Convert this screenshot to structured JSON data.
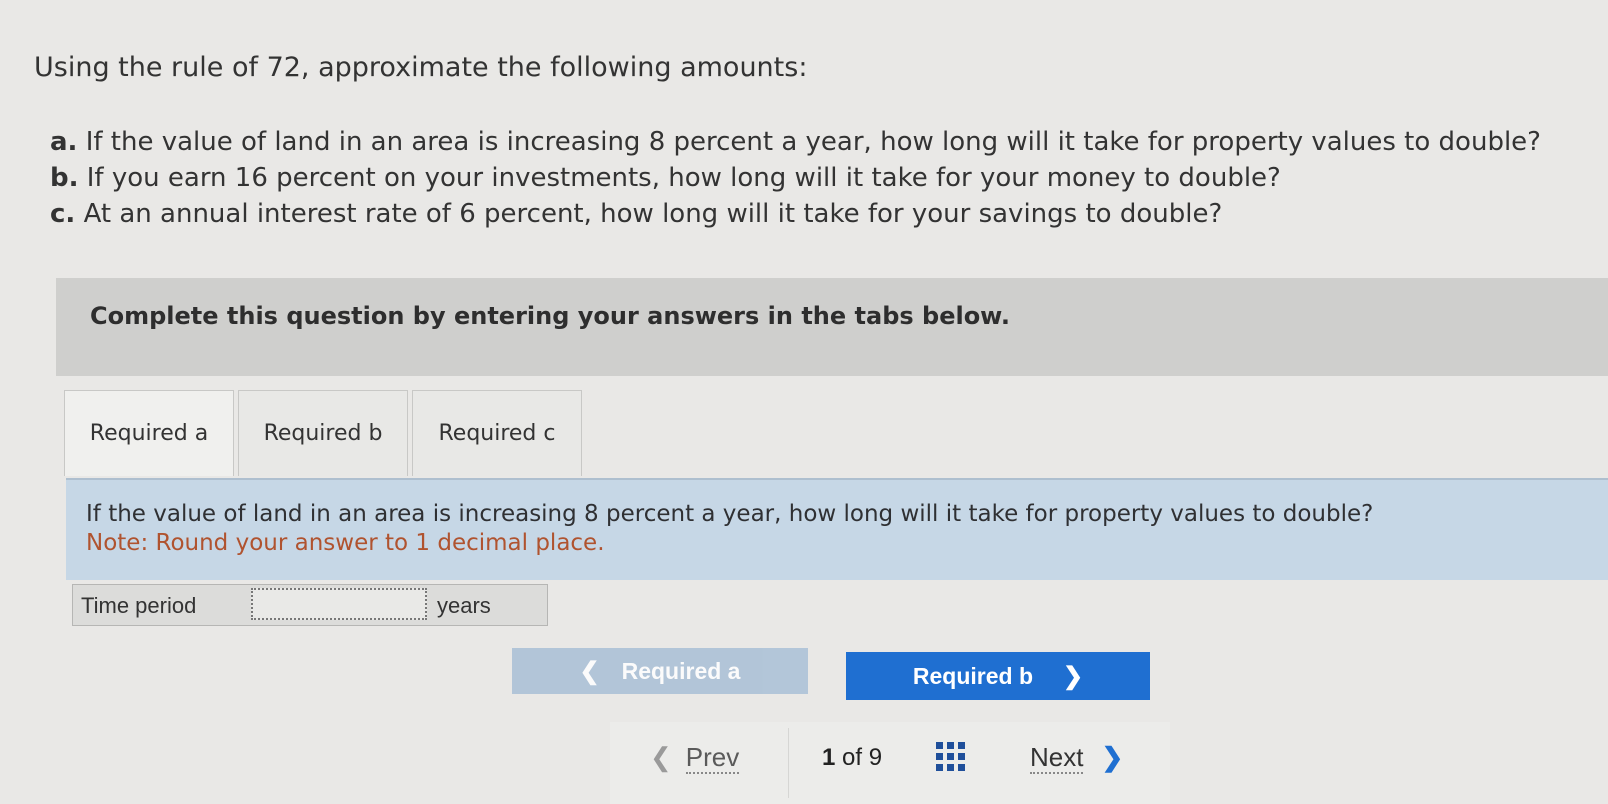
{
  "question": {
    "intro": "Using the rule of 72, approximate the following amounts:",
    "items": [
      {
        "letter": "a.",
        "text": "If the value of land in an area is increasing 8 percent a year, how long will it take for property values to double?"
      },
      {
        "letter": "b.",
        "text": "If you earn 16 percent on your investments, how long will it take for your money to double?"
      },
      {
        "letter": "c.",
        "text": "At an annual interest rate of 6 percent, how long will it take for your savings to double?"
      }
    ]
  },
  "banner": {
    "text": "Complete this question by entering your answers in the tabs below."
  },
  "tabs": [
    {
      "label": "Required a",
      "active": true
    },
    {
      "label": "Required b",
      "active": false
    },
    {
      "label": "Required c",
      "active": false
    }
  ],
  "prompt": {
    "text": "If the value of land in an area is increasing 8 percent a year, how long will it take for property values to double?",
    "note": "Note: Round your answer to 1 decimal place."
  },
  "answer": {
    "label": "Time period",
    "value": "",
    "unit": "years"
  },
  "tab_nav": {
    "prev_label": "Required a",
    "next_label": "Required b"
  },
  "pager": {
    "prev_label": "Prev",
    "current": "1",
    "of_label": "of 9",
    "next_label": "Next"
  },
  "colors": {
    "primary_button": "#1f6fd1",
    "disabled_button": "#a9bfd6",
    "prompt_background": "#c6d7e6",
    "note_text": "#b0532f"
  }
}
